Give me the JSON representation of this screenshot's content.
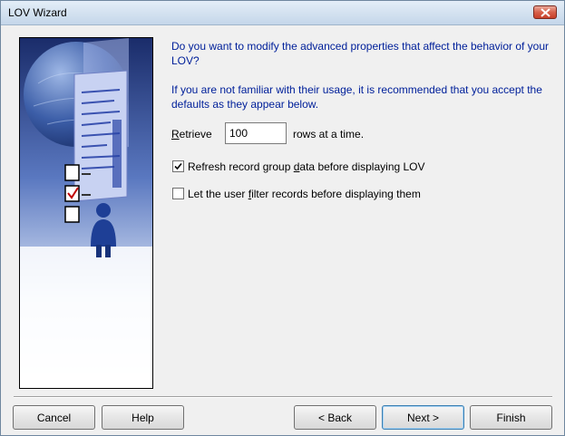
{
  "window": {
    "title": "LOV Wizard"
  },
  "content": {
    "question": "Do you want to modify the advanced properties that affect the behavior of your LOV?",
    "advice": "If you are not familiar with their usage, it is recommended that you accept the defaults as they appear below."
  },
  "retrieve": {
    "label_mnemonic": "R",
    "label_rest": "etrieve",
    "value": "100",
    "suffix": "rows at a time."
  },
  "options": [
    {
      "label_before": "Refresh record group ",
      "mnemonic": "d",
      "label_after": "ata before displaying LOV",
      "checked": true
    },
    {
      "label_before": "Let the user ",
      "mnemonic": "f",
      "label_after": "ilter records before displaying them",
      "checked": false
    }
  ],
  "buttons": {
    "cancel": "Cancel",
    "help": "Help",
    "back": "< Back",
    "next": "Next >",
    "finish": "Finish"
  },
  "colors": {
    "instruction_text": "#00209a",
    "close_button": "#c7402a"
  }
}
